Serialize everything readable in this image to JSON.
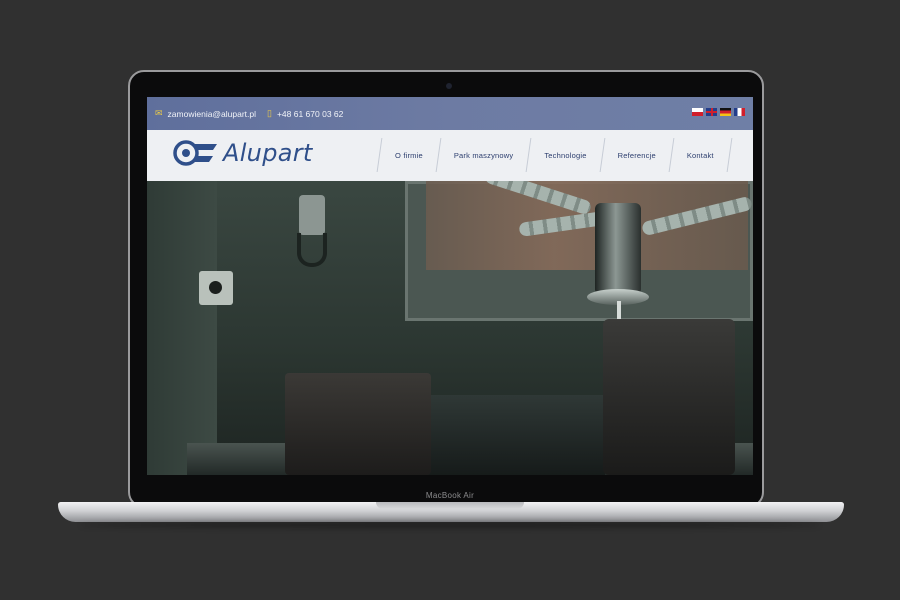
{
  "device": {
    "model_label": "MacBook Air"
  },
  "topbar": {
    "email": "zamowienia@alupart.pl",
    "phone": "+48 61 670 03 62",
    "email_icon": "envelope-icon",
    "phone_icon": "phone-icon",
    "languages": [
      {
        "code": "pl",
        "icon": "flag-pl-icon"
      },
      {
        "code": "en",
        "icon": "flag-en-icon"
      },
      {
        "code": "de",
        "icon": "flag-de-icon"
      },
      {
        "code": "fr",
        "icon": "flag-fr-icon"
      }
    ]
  },
  "header": {
    "logo_text": "Alupart",
    "nav": [
      {
        "label": "O firmie"
      },
      {
        "label": "Park maszynowy"
      },
      {
        "label": "Technologie"
      },
      {
        "label": "Referencje"
      },
      {
        "label": "Kontakt"
      }
    ]
  },
  "colors": {
    "brand_blue": "#2f4f8a",
    "topbar_blue": "#6d7ba3",
    "accent_yellow": "#e7c84a"
  }
}
